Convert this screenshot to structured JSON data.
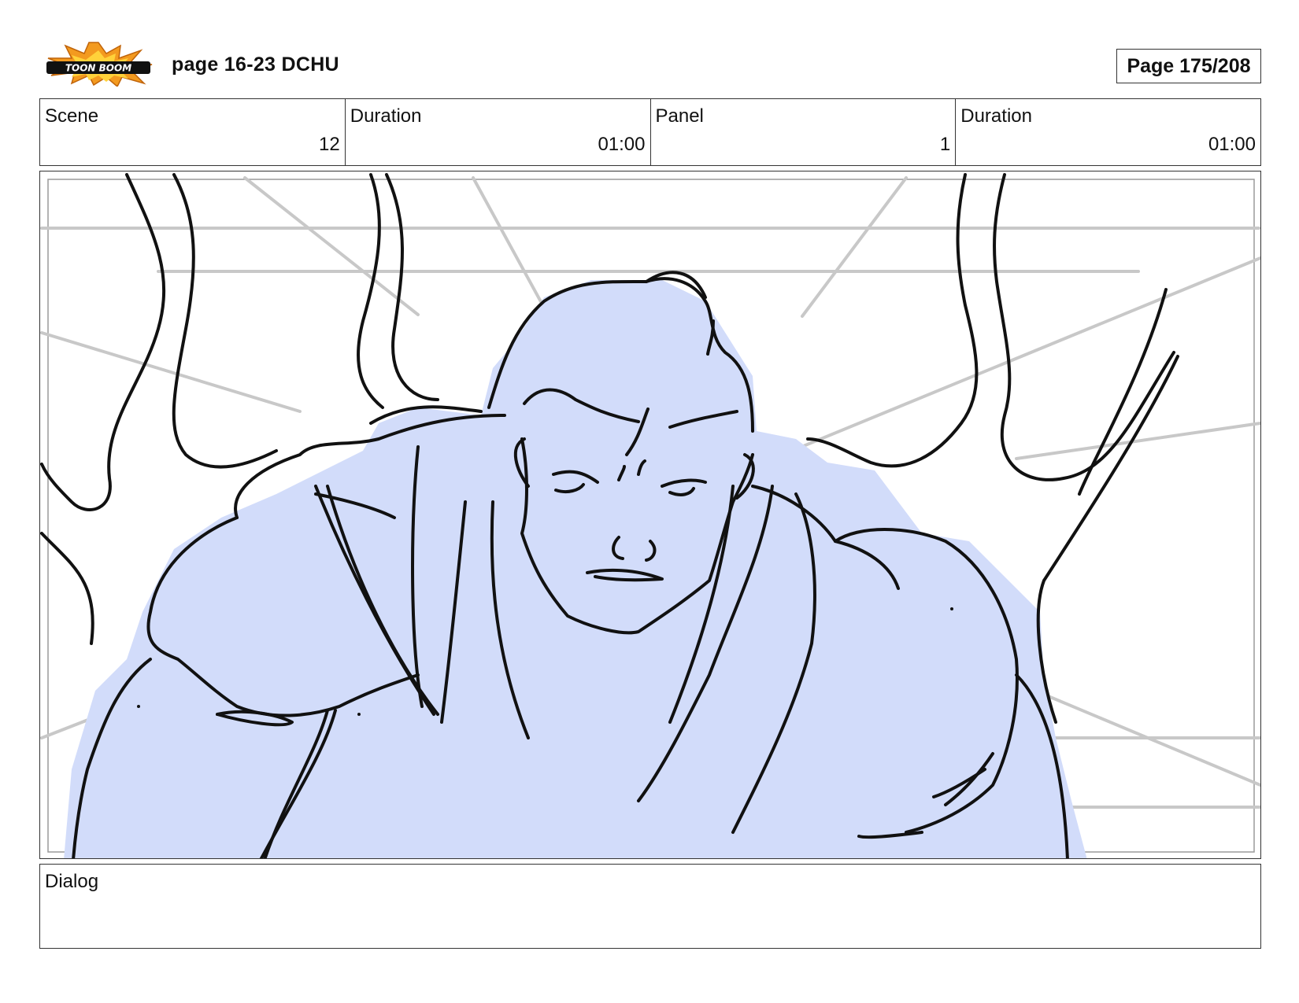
{
  "header": {
    "logo_text": "TOON BOOM",
    "title": "page 16-23 DCHU",
    "page_counter": "Page 175/208"
  },
  "info": {
    "scene_label": "Scene",
    "scene_value": "12",
    "scene_duration_label": "Duration",
    "scene_duration_value": "01:00",
    "panel_label": "Panel",
    "panel_value": "1",
    "panel_duration_label": "Duration",
    "panel_duration_value": "01:00"
  },
  "dialog": {
    "label": "Dialog",
    "text": ""
  },
  "colors": {
    "figure_fill": "#d2dcfa",
    "speed_lines": "#c8c8c8",
    "ink": "#111111",
    "logo_burst": "#f39a1f"
  },
  "icons": {
    "logo": "toon-boom-logo-icon"
  }
}
